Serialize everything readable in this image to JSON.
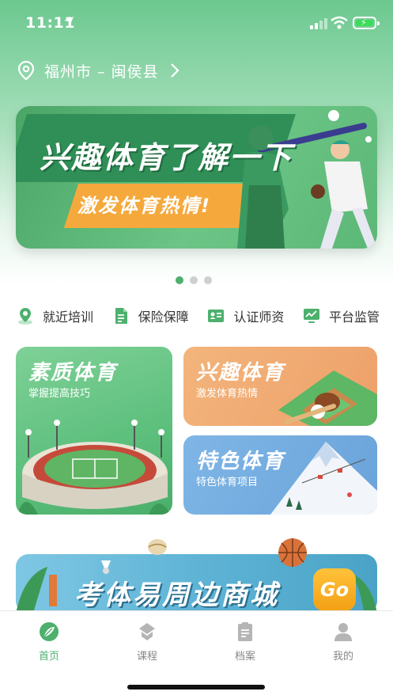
{
  "status_bar": {
    "time": "11:11"
  },
  "location": {
    "text": "福州市 – 闽侯县"
  },
  "banner": {
    "title": "兴趣体育了解一下",
    "subtitle": "激发体育热情!"
  },
  "carousel": {
    "count": 3,
    "active_index": 0
  },
  "quick_nav": [
    {
      "label": "就近培训",
      "icon": "location-icon"
    },
    {
      "label": "保险保障",
      "icon": "document-icon"
    },
    {
      "label": "认证师资",
      "icon": "id-card-icon"
    },
    {
      "label": "平台监管",
      "icon": "monitor-icon"
    }
  ],
  "cards": {
    "quality": {
      "title": "素质体育",
      "subtitle": "掌握提高技巧"
    },
    "interest": {
      "title": "兴趣体育",
      "subtitle": "激发体育热情"
    },
    "special": {
      "title": "特色体育",
      "subtitle": "特色体育项目"
    }
  },
  "mall": {
    "title": "考体易周边商城",
    "go_label": "Go"
  },
  "tabbar": [
    {
      "label": "首页",
      "icon": "home-leaf-icon",
      "active": true
    },
    {
      "label": "课程",
      "icon": "course-icon",
      "active": false
    },
    {
      "label": "档案",
      "icon": "archive-icon",
      "active": false
    },
    {
      "label": "我的",
      "icon": "profile-icon",
      "active": false
    }
  ],
  "colors": {
    "accent": "#4db06d",
    "inactive_tab": "#888888"
  }
}
